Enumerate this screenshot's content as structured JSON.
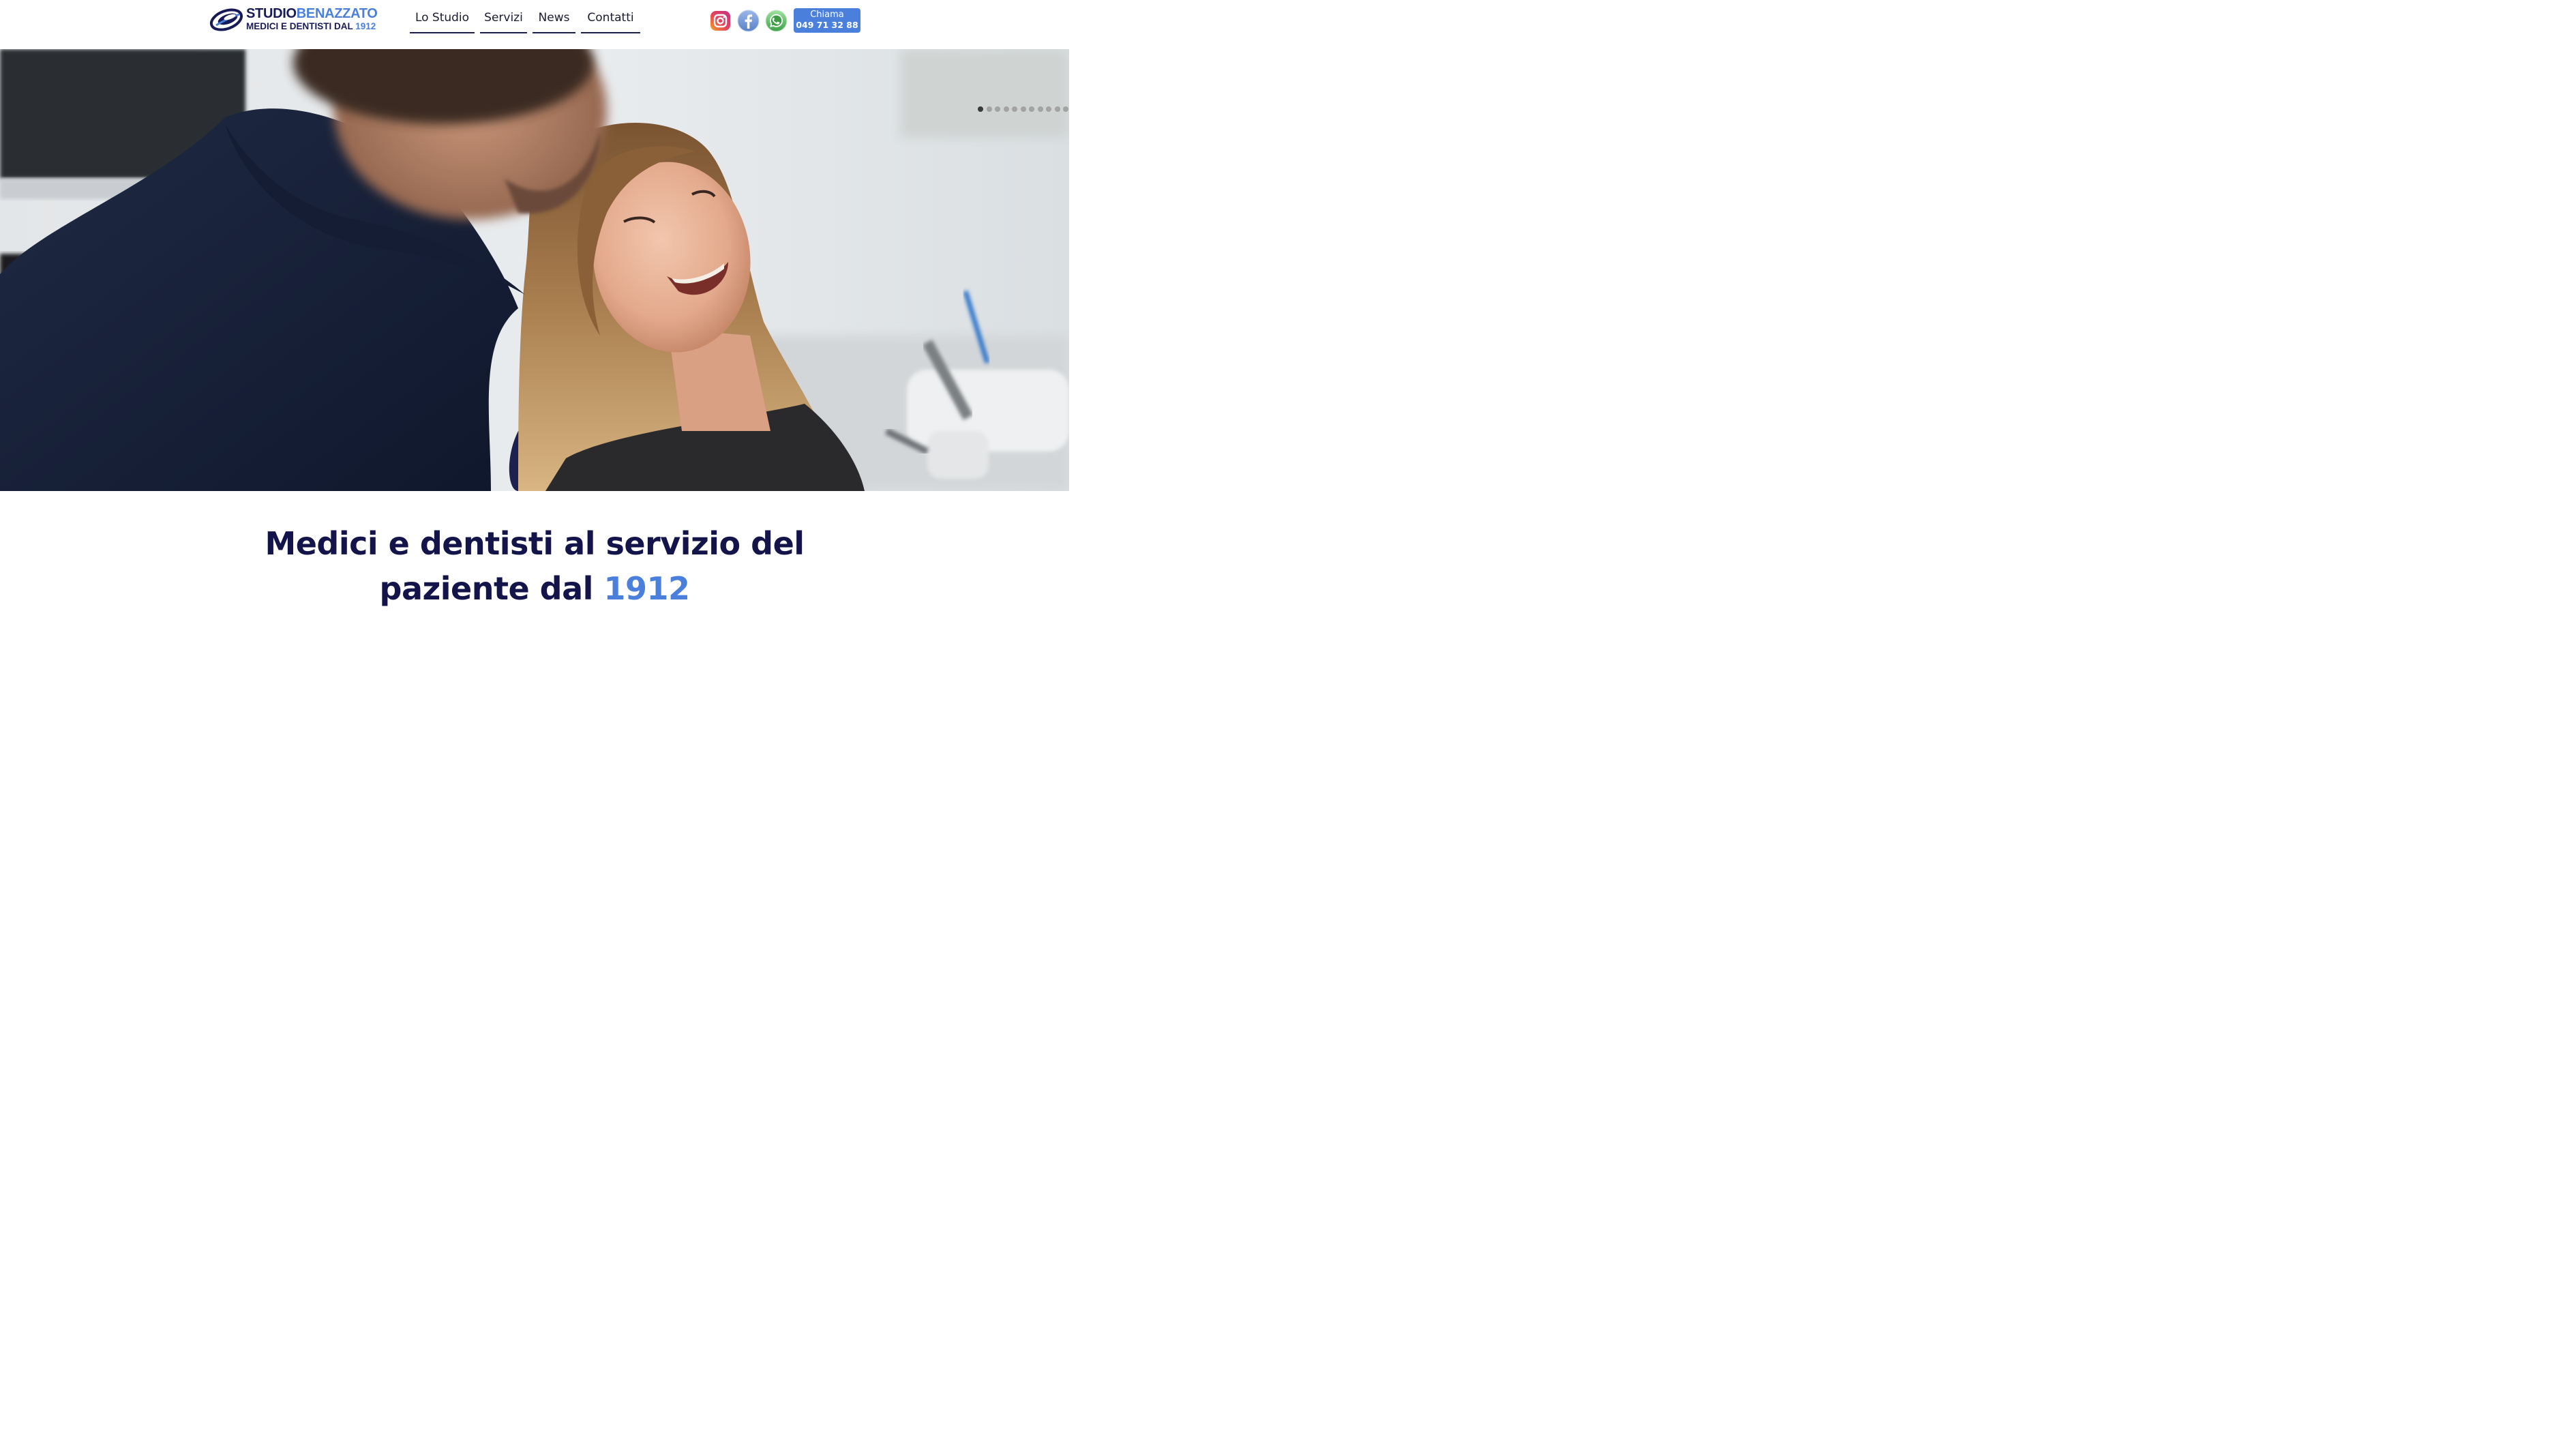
{
  "brand": {
    "name_part1": "STUDIO",
    "name_part2": "BENAZZATO",
    "tagline_part1": "MEDICI E DENTISTI DAL ",
    "tagline_year": "1912",
    "color_dark": "#171a57",
    "color_accent": "#4a80dc"
  },
  "nav": {
    "items": [
      {
        "label": "Lo Studio"
      },
      {
        "label": "Servizi"
      },
      {
        "label": "News"
      },
      {
        "label": "Contatti"
      }
    ]
  },
  "social": [
    {
      "icon": "instagram-icon"
    },
    {
      "icon": "facebook-icon"
    },
    {
      "icon": "whatsapp-icon"
    }
  ],
  "call": {
    "label": "Chiama",
    "number": "049 71 32 88"
  },
  "slider": {
    "slide_count": 11,
    "active_index": 0
  },
  "headline": {
    "line1": "Medici e dentisti al servizio del",
    "line2_text": "paziente dal ",
    "line2_year": "1912"
  }
}
